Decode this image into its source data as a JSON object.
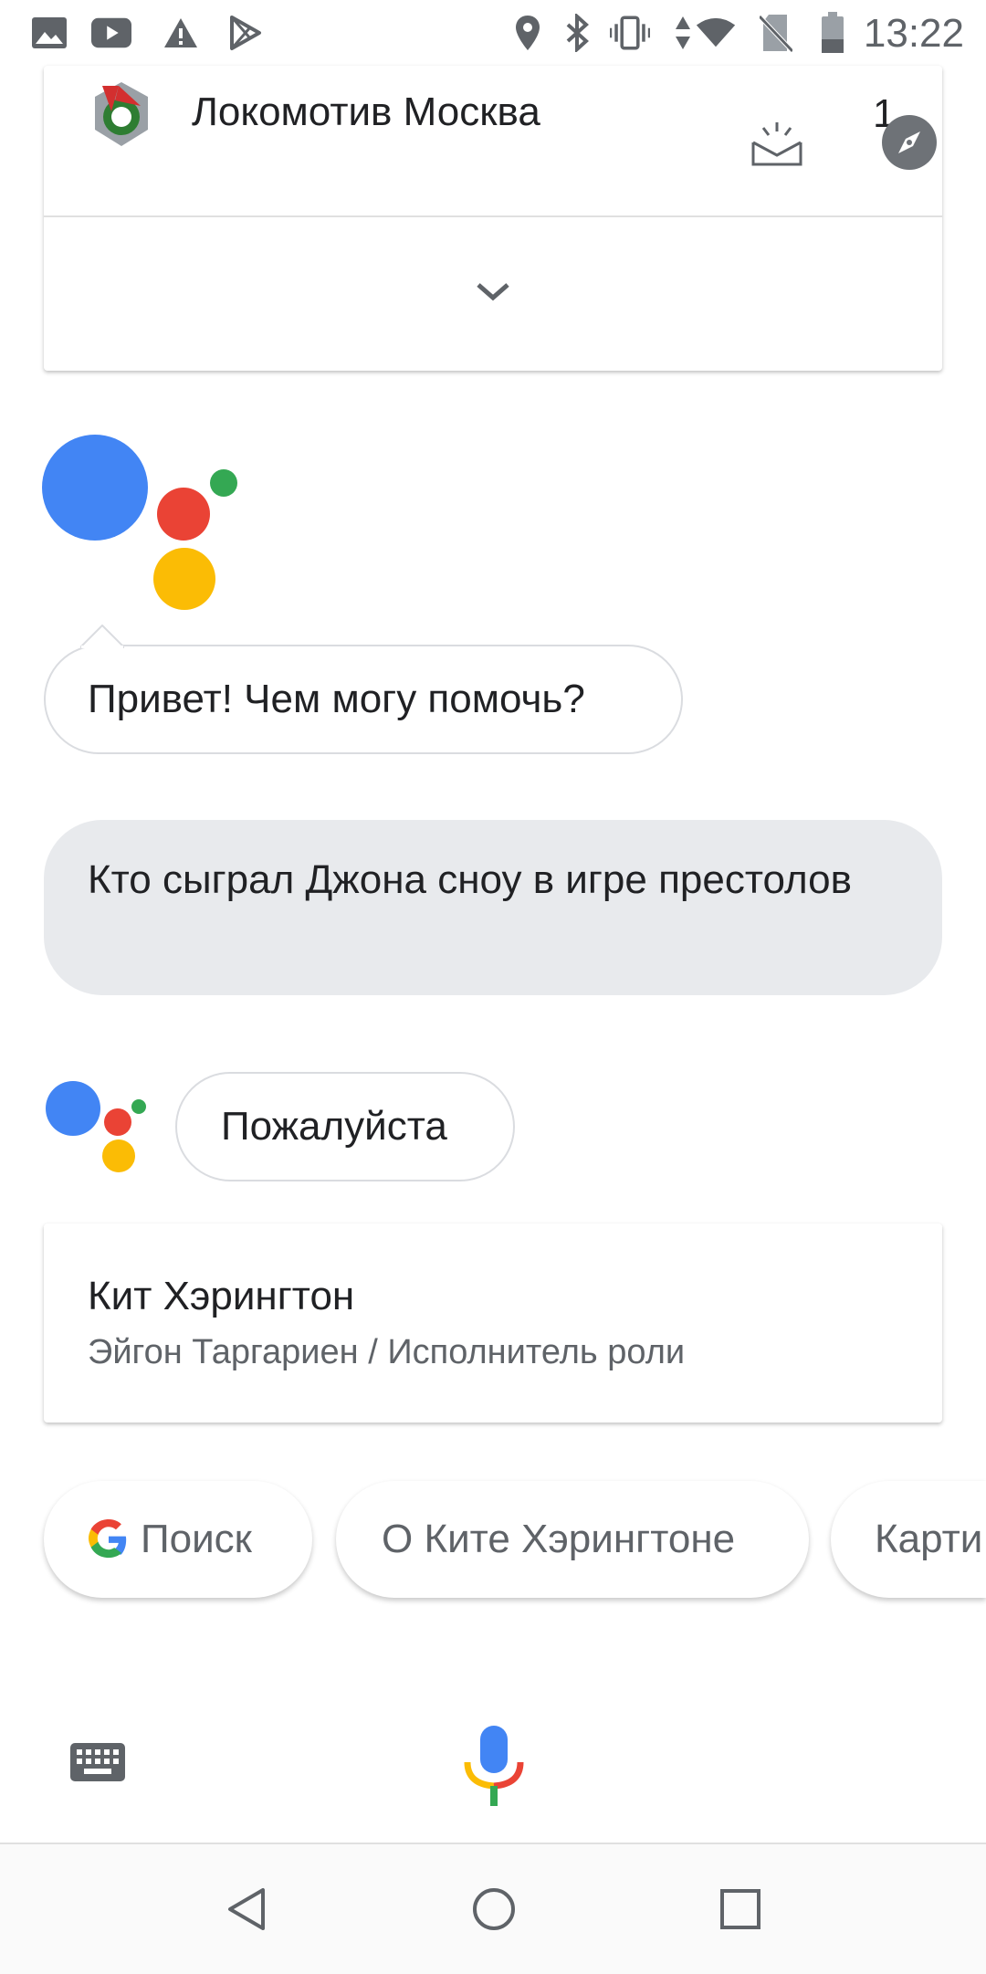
{
  "status_bar": {
    "time": "13:22",
    "icons": [
      "image-icon",
      "youtube-icon",
      "warning-icon",
      "play-store-icon",
      "location-icon",
      "bluetooth-icon",
      "vibrate-icon",
      "data-arrows-icon",
      "wifi-icon",
      "no-sim-icon",
      "battery-icon"
    ]
  },
  "sports_card": {
    "team_name": "Локомотив Москва",
    "score": "1",
    "logo_icon": "lokomotiv-logo",
    "expand_icon": "chevron-down-icon"
  },
  "conversation": {
    "assistant_greeting": "Привет! Чем могу помочь?",
    "user_query": "Кто сыграл Джона сноу в игре престолов",
    "assistant_reply": "Пожалуйста",
    "result": {
      "title": "Кит Хэрингтон",
      "subtitle": "Эйгон Таргариен / Исполнитель роли"
    }
  },
  "suggestions": [
    {
      "label": "Поиск",
      "icon": "google-g-icon"
    },
    {
      "label": "О Ките Хэрингтоне"
    },
    {
      "label": "Карти"
    }
  ],
  "input_bar": {
    "keyboard_icon": "keyboard-icon",
    "mic_icon": "microphone-icon"
  },
  "colors": {
    "blue": "#4285F4",
    "red": "#EA4335",
    "yellow": "#FBBC05",
    "green": "#34A853",
    "user_bubble": "#e8eaed"
  }
}
